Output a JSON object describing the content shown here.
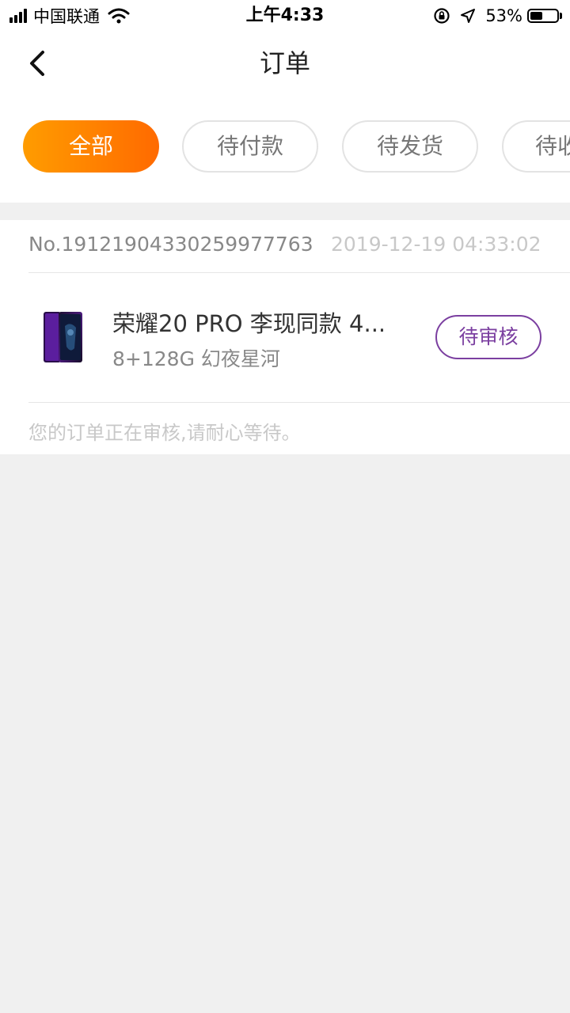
{
  "status_bar": {
    "carrier": "中国联通",
    "time": "上午4:33",
    "battery_percent": "53%",
    "battery_level": 0.53,
    "icons": [
      "signal-icon",
      "wifi-icon",
      "rotation-lock-icon",
      "location-arrow-icon",
      "battery-icon"
    ]
  },
  "nav": {
    "title": "订单",
    "back_icon": "chevron-left-icon"
  },
  "tabs": [
    {
      "label": "全部",
      "active": true
    },
    {
      "label": "待付款",
      "active": false
    },
    {
      "label": "待发货",
      "active": false
    },
    {
      "label": "待收货",
      "active": false
    }
  ],
  "order": {
    "number": "No.19121904330259977763",
    "time": "2019-12-19 04:33:02",
    "product_name": "荣耀20 PRO 李现同款 4...",
    "product_spec": "8+128G 幻夜星河",
    "status": "待审核",
    "note": "您的订单正在审核,请耐心等待。"
  },
  "colors": {
    "accent_start": "#ff9c00",
    "accent_end": "#ff6a00",
    "status_purple": "#7b3fa0",
    "page_background": "#f0f0f0"
  }
}
